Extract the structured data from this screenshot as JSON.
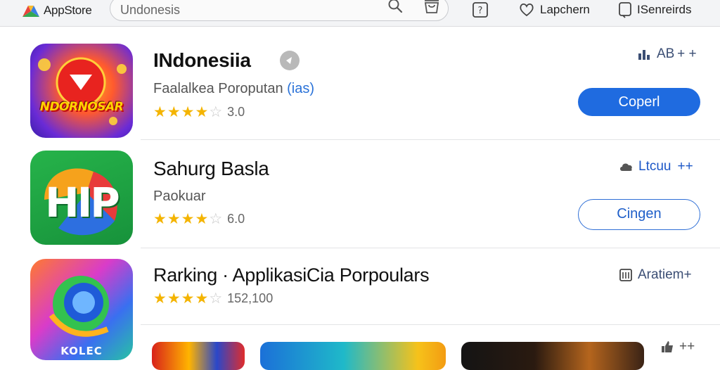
{
  "topbar": {
    "logo_text": "AppStore",
    "search": {
      "value": "Undonesis"
    },
    "link1": "Lapchern",
    "link2": "ISenreirds"
  },
  "apps": [
    {
      "title": "INdonesiia",
      "subtitle": "Faalalkea Poroputan",
      "subtitle_tag": "(ias)",
      "rating": {
        "stars": 4,
        "value": "3.0"
      },
      "side_label": "AB + +",
      "button": "Coperl",
      "icon_text": "NDORNOSAR"
    },
    {
      "title": "Sahurg Basla",
      "subtitle": "Paokuar",
      "rating": {
        "stars": 4,
        "value": "6.0"
      },
      "side_label": "Ltcuu  ++",
      "button": "Cingen",
      "icon_text": "HIP"
    },
    {
      "title": "Rarking · ApplikasiCia Porpoulars",
      "rating": {
        "stars": 4,
        "value": "152,100"
      },
      "side_label": "Aratiem+",
      "icon_text": "KOLEC"
    }
  ],
  "bottom_side_label": "++",
  "colors": {
    "accent": "#1f6be0",
    "star": "#f4b400",
    "side_text": "#3b4e74"
  }
}
